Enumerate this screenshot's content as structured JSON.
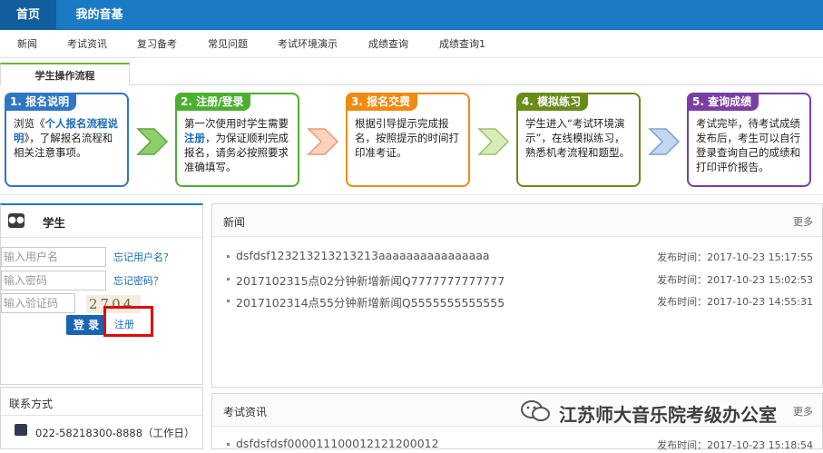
{
  "topbar": {
    "tabs": [
      "首页",
      "我的音基"
    ]
  },
  "nav": {
    "items": [
      "新闻",
      "考试资讯",
      "复习备考",
      "常见问题",
      "考试环境演示",
      "成绩查询",
      "成绩查询1"
    ]
  },
  "flow": {
    "tab_label": "学生操作流程",
    "steps": [
      {
        "title": "1. 报名说明",
        "color": "#2f76c4",
        "parts": [
          "浏览《",
          "个人报名流程说明",
          "》，了解报名流程和相关注意事项。"
        ]
      },
      {
        "title": "2. 注册/登录",
        "color": "#4caf30",
        "parts": [
          "第一次使用时学生需要",
          "注册",
          "，为保证顺利完成报名，请务必按照要求准确填写。"
        ]
      },
      {
        "title": "3. 报名交费",
        "color": "#f08a13",
        "parts": [
          "根据引导提示完成报名，按照提示的时间打印准考证。"
        ]
      },
      {
        "title": "4. 模拟练习",
        "color": "#6a8a1a",
        "parts": [
          "学生进入“考试环境演示”，在线模拟练习，熟悉机考流程和题型。"
        ]
      },
      {
        "title": "5. 查询成绩",
        "color": "#7a3fa3",
        "parts": [
          "考试完毕，待考试成绩发布后，考生可以自行登录查询自己的成绩和打印评价报告。"
        ]
      }
    ]
  },
  "login": {
    "title": "学生",
    "username_placeholder": "输入用户名",
    "password_placeholder": "输入密码",
    "captcha_placeholder": "输入验证码",
    "captcha_text": "2704",
    "forgot_username": "忘记用户名？",
    "forgot_password": "忘记密码？",
    "login_label": "登 录",
    "register_label": "注册"
  },
  "contact": {
    "title": "联系方式",
    "phone": "022-58218300-8888（工作日）"
  },
  "news": {
    "title": "新闻",
    "more": "更多",
    "items": [
      {
        "title": "dsfdsf123213213213213aaaaaaaaaaaaaaaa",
        "date": "发布时间：2017-10-23 15:17:55"
      },
      {
        "title": "2017102315点02分钟新增新闻Q7777777777777",
        "date": "发布时间：2017-10-23 15:02:53"
      },
      {
        "title": "2017102314点55分钟新增新闻Q5555555555555",
        "date": "发布时间：2017-10-23 14:55:31"
      }
    ]
  },
  "exam": {
    "title": "考试资讯",
    "more": "更多",
    "items": [
      {
        "title": "dsfdsfdsf000011100012121200012",
        "date": "发布时间：2017-10-23 15:18:54"
      }
    ]
  },
  "watermark": {
    "text": "江苏师大音乐院考级办公室"
  }
}
